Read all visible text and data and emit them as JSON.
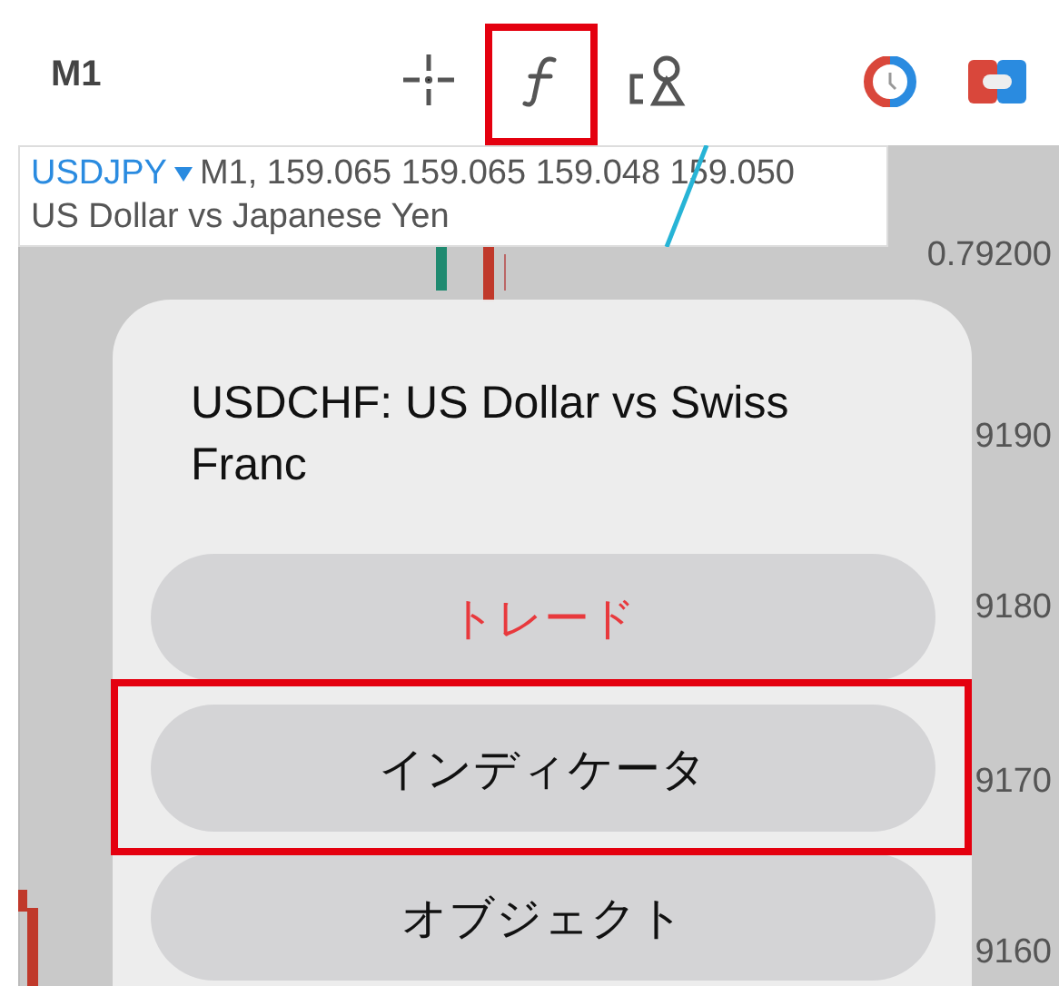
{
  "toolbar": {
    "timeframe": "M1"
  },
  "legend": {
    "symbol": "USDJPY",
    "quote": "M1, 159.065 159.065 159.048 159.050",
    "description": "US Dollar vs Japanese Yen"
  },
  "price_axis": [
    "0.79200",
    "9190",
    "9180",
    "9170",
    "9160"
  ],
  "sheet": {
    "title": "USDCHF: US Dollar vs Swiss Franc",
    "actions": [
      {
        "label": "トレード",
        "kind": "accent"
      },
      {
        "label": "インディケータ",
        "kind": "default"
      },
      {
        "label": "オブジェクト",
        "kind": "default"
      }
    ]
  }
}
